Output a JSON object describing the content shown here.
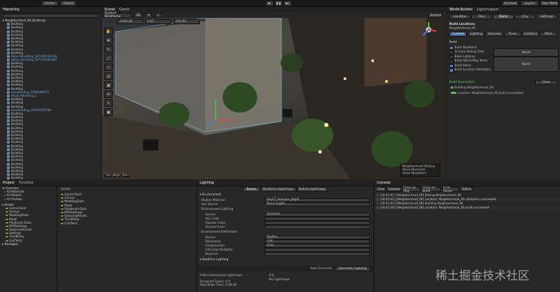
{
  "toolbar": {
    "left": [
      "Center",
      "Global"
    ],
    "right": [
      "Account",
      "Layers",
      "User Work"
    ]
  },
  "hierarchy": {
    "tab": "Hierarchy",
    "root": "NeighborHood_06_Buildings",
    "rows": [
      {
        "label": "Building",
        "blue": false
      },
      {
        "label": "Building",
        "blue": false
      },
      {
        "label": "Building",
        "blue": false
      },
      {
        "label": "Building",
        "blue": false
      },
      {
        "label": "Building",
        "blue": false
      },
      {
        "label": "Building",
        "blue": false
      },
      {
        "label": "Building",
        "blue": false
      },
      {
        "label": "Building",
        "blue": false
      },
      {
        "label": "Building",
        "blue": false
      },
      {
        "label": "RejoiceBuilding_587085741768",
        "blue": true
      },
      {
        "label": "RejoiceBuilding_587145181089",
        "blue": true
      },
      {
        "label": "Building",
        "blue": false
      },
      {
        "label": "Building",
        "blue": false
      },
      {
        "label": "Building",
        "blue": false
      },
      {
        "label": "Building",
        "blue": false
      },
      {
        "label": "Building",
        "blue": false
      },
      {
        "label": "Building",
        "blue": false
      },
      {
        "label": "Building",
        "blue": false
      },
      {
        "label": "Building",
        "blue": false
      },
      {
        "label": "RareBuilding_1506488071",
        "blue": true
      },
      {
        "label": "RejoiceBuilding_1",
        "blue": true
      },
      {
        "label": "Building",
        "blue": false
      },
      {
        "label": "Building",
        "blue": false
      },
      {
        "label": "Building",
        "blue": false
      },
      {
        "label": "RareBuilding_15954552548",
        "blue": true
      },
      {
        "label": "Building",
        "blue": false
      },
      {
        "label": "Building",
        "blue": false
      },
      {
        "label": "Building",
        "blue": false
      },
      {
        "label": "Building",
        "blue": false
      },
      {
        "label": "Building",
        "blue": false
      },
      {
        "label": "Building",
        "blue": false
      },
      {
        "label": "Building",
        "blue": false
      },
      {
        "label": "Building",
        "blue": false
      },
      {
        "label": "Building",
        "blue": false
      },
      {
        "label": "Building",
        "blue": false
      },
      {
        "label": "Building",
        "blue": false
      },
      {
        "label": "Building",
        "blue": false
      },
      {
        "label": "Building",
        "blue": false
      },
      {
        "label": "Building",
        "blue": false
      },
      {
        "label": "Building",
        "blue": false
      },
      {
        "label": "Building",
        "blue": false
      },
      {
        "label": "Building",
        "blue": false
      },
      {
        "label": "Building",
        "blue": false
      },
      {
        "label": "Building",
        "blue": false
      }
    ]
  },
  "scene": {
    "tabs": [
      "Scene",
      "Game"
    ],
    "draw_mode": "Shaded Wireframe",
    "coord": [
      "-1056.38",
      "5.87",
      "243.90"
    ],
    "bottom_label": "Scn_Night_Rain",
    "overlay": [
      "Neighborhood Display",
      "Show Navmesh",
      "Show Neighbors"
    ]
  },
  "right": {
    "title": "World Builder",
    "tab2": "Lightmapper",
    "tabs": [
      "Location",
      "Plan",
      "Build",
      "City",
      "Settings"
    ],
    "section": "Build Locations",
    "location": "Neighborhood_06",
    "subtabs": [
      "Current",
      "Lighting",
      "Volumes",
      "Trees",
      "Colliders",
      "More"
    ],
    "build_header": "Build",
    "checks": [
      {
        "label": "Build NavMesh",
        "checked": true
      },
      {
        "label": "Include Debug Data",
        "checked": false
      },
      {
        "label": "Bake Lighting",
        "checked": false
      },
      {
        "label": "Build World Map Mesh",
        "checked": false
      },
      {
        "label": "Build Baker",
        "checked": true
      },
      {
        "label": "Build Location Metadata",
        "checked": true
      }
    ],
    "build_button": "Build",
    "build_button2": "Build",
    "succeeded_header": "Build Succeeded",
    "clear_label": "Clear",
    "succeeded_item": "Building Neighborhood_06",
    "log_item": "Location: Neighborhood_06 build succeeded"
  },
  "project": {
    "tabs": [
      "Project",
      "Timeline"
    ],
    "favorites": "Favorites",
    "fav_items": [
      "All Materials",
      "All Models",
      "All Prefabs"
    ],
    "assets": "Assets",
    "asset_tree": [
      "GameClient",
      "Scenes",
      "ModdingTools",
      "Mods",
      "Polybrush Data",
      "RPGSettings",
      "SeasonalAssets",
      "Settings",
      "ThirdParty",
      "UnitTests"
    ],
    "packages": "Packages",
    "content_header": "Assets",
    "content_items": [
      "GameClient",
      "Scenes",
      "ModdingTools",
      "Mods",
      "Polybrush Data",
      "RPGSettings",
      "SeasonalAssets",
      "ThirdParty",
      "UnitTests"
    ]
  },
  "lighting": {
    "tab": "Lighting",
    "subtabs": [
      "Scene",
      "Realtime Lightmaps",
      "Baked Lightmaps"
    ],
    "environment": "Environment",
    "rows": [
      {
        "label": "Skybox Material",
        "value": "SkyCT_Seasons_Night"
      },
      {
        "label": "Sun Source",
        "value": "None (Light)"
      }
    ],
    "env_lighting": "Environment Lighting",
    "env_rows": [
      {
        "label": "Source",
        "value": "Gradient"
      },
      {
        "label": "Sky Color",
        "value": ""
      },
      {
        "label": "Equator Color",
        "value": ""
      },
      {
        "label": "Ground Color",
        "value": ""
      }
    ],
    "env_reflections": "Environment Reflections",
    "refl_rows": [
      {
        "label": "Source",
        "value": "Skybox"
      },
      {
        "label": "Resolution",
        "value": "128"
      },
      {
        "label": "Compression",
        "value": "Auto"
      },
      {
        "label": "Intensity Multiplier",
        "value": ""
      },
      {
        "label": "Bounces",
        "value": ""
      }
    ],
    "realtime": "Realtime Lighting",
    "auto_generate": "Auto Generate",
    "generate_btn": "Generate Lighting",
    "stats": [
      "0 Non-Directional Lightmaps",
      "Occupied Texels: 0.0",
      "Total Bake Time: 0:00:00"
    ],
    "stats_right": [
      "0 B",
      "No Lightmaps"
    ]
  },
  "console": {
    "tab": "Console",
    "buttons": [
      "Clear",
      "Collapse",
      "Clear on Play",
      "Clear on Build",
      "Error Pause",
      "Editor"
    ],
    "logs": [
      "[18:41:01] [Neighborhood_06] Baking Neighborhood_06",
      "[18:41:02] [Neighborhood_06] Location: Neighborhood_06 validation succeeded",
      "[18:41:02] [Neighborhood_06] Building Neighborhood_06",
      "[18:42:30] [Neighborhood_06] Location: Neighborhood_06 build succeeded"
    ]
  },
  "watermark": "稀土掘金技术社区"
}
